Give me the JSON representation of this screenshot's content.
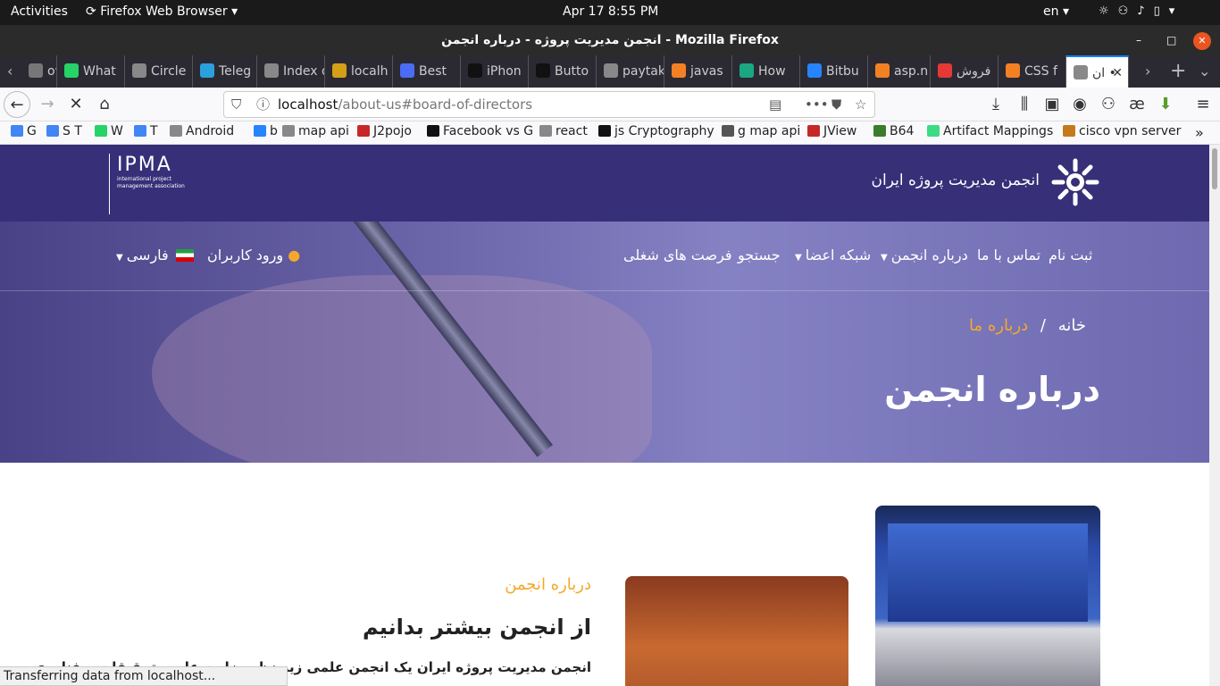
{
  "system": {
    "activities": "Activities",
    "app": "Firefox Web Browser",
    "clock": "Apr 17   8:55 PM",
    "lang": "en"
  },
  "window": {
    "title": "انجمن مدیریت پروژه - درباره انجمن - Mozilla Firefox"
  },
  "tabs": [
    {
      "label": "ow t",
      "color": "#777"
    },
    {
      "label": "What",
      "color": "#25d366"
    },
    {
      "label": "Circle",
      "color": "#888"
    },
    {
      "label": "Teleg",
      "color": "#2aa1da"
    },
    {
      "label": "Index of",
      "color": "#888"
    },
    {
      "label": "localh",
      "color": "#d4a017"
    },
    {
      "label": "Best",
      "color": "#4a6cf7"
    },
    {
      "label": "iPhon",
      "color": "#111"
    },
    {
      "label": "Butto",
      "color": "#111"
    },
    {
      "label": "paytakh",
      "color": "#888"
    },
    {
      "label": "javas",
      "color": "#f48024"
    },
    {
      "label": "How",
      "color": "#1ba784"
    },
    {
      "label": "Bitbu",
      "color": "#2684ff"
    },
    {
      "label": "asp.n",
      "color": "#f48024"
    },
    {
      "label": "فروش",
      "color": "#e53935"
    },
    {
      "label": "CSS f",
      "color": "#f48024"
    },
    {
      "label": "ان •",
      "color": "#888"
    }
  ],
  "url": {
    "host": "localhost",
    "path": "/about-us#board-of-directors"
  },
  "bookmarks": [
    {
      "label": "G",
      "color": "#4285f4"
    },
    {
      "label": "S T",
      "color": "#4285f4"
    },
    {
      "label": "W",
      "color": "#25d366"
    },
    {
      "label": "T",
      "color": "#4285f4"
    },
    {
      "label": "Android",
      "color": "#888"
    },
    {
      "label": "b",
      "color": "#2684ff"
    },
    {
      "label": "map api",
      "color": "#888"
    },
    {
      "label": "J2pojo",
      "color": "#c62828"
    },
    {
      "label": "Facebook vs G",
      "color": "#111"
    },
    {
      "label": "react",
      "color": "#888"
    },
    {
      "label": "js Cryptography",
      "color": "#111"
    },
    {
      "label": "g map api",
      "color": "#555"
    },
    {
      "label": "JView",
      "color": "#c62828"
    },
    {
      "label": "B64",
      "color": "#3a7d2c"
    },
    {
      "label": "Artifact Mappings",
      "color": "#3ddc84"
    },
    {
      "label": "cisco vpn server",
      "color": "#c47a1a"
    }
  ],
  "site": {
    "brand": "انجمن مدیریت پروژه ایران",
    "ipma_logo": "IPMA",
    "ipma_sub": "international project management association",
    "menu": {
      "register": "ثبت نام",
      "contact": "تماس با ما",
      "about": "درباره انجمن",
      "network": "شبکه اعضا",
      "search": "جستجو",
      "jobs": "فرصت های شغلی",
      "login": "ورود کاربران",
      "language": "فارسی"
    },
    "breadcrumb_home": "خانه",
    "breadcrumb_sep": "/",
    "breadcrumb_current": "درباره ما",
    "hero_title": "درباره انجمن",
    "section_label": "درباره انجمن",
    "section_title": "از انجمن بیشتر بدانیم",
    "section_text": "انجمن مدیریت پروژه ایران یک انجمن علمی زیر نظر وزارت علوم، تحقیقات و فناوری"
  },
  "status_text": "Transferring data from localhost..."
}
